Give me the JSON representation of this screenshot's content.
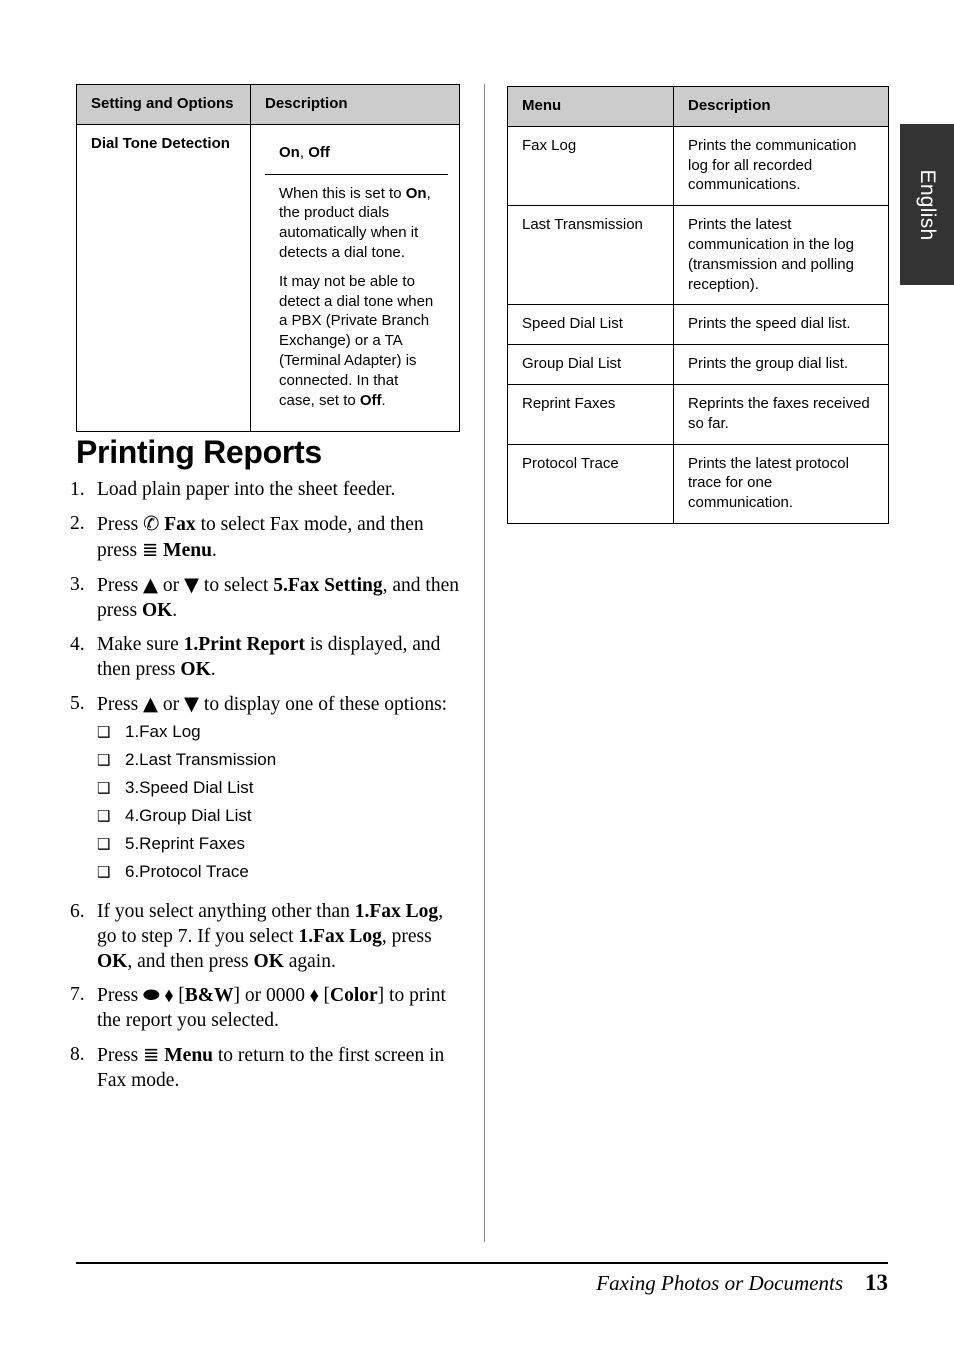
{
  "language_tab": {
    "label": "English"
  },
  "left_table": {
    "headers": [
      "Setting and Options",
      "Description"
    ],
    "row": {
      "setting": "Dial Tone Detection",
      "options_line_a": "On",
      "options_sep": ", ",
      "options_line_b": "Off",
      "desc_p1_a": "When this is set to ",
      "desc_p1_bold": "On",
      "desc_p1_b": ", the product dials automatically when it detects a dial tone.",
      "desc_p2_a": "It may not be able to detect a dial tone when a PBX (Private Branch Exchange) or a TA (Terminal Adapter) is connected. In that case, set to ",
      "desc_p2_bold": "Off",
      "desc_p2_b": "."
    }
  },
  "section": {
    "title": "Printing Reports"
  },
  "steps": [
    {
      "num": "1.",
      "parts": [
        {
          "t": "Load plain paper into the sheet feeder."
        }
      ]
    },
    {
      "num": "2.",
      "parts": [
        {
          "t": "Press "
        },
        {
          "t": "✆",
          "icon": "fax-icon"
        },
        {
          "t": " "
        },
        {
          "t": "Fax",
          "b": true
        },
        {
          "t": " to select Fax mode, and then press "
        },
        {
          "t": "≣",
          "icon": "menu-icon"
        },
        {
          "t": " "
        },
        {
          "t": "Menu",
          "b": true
        },
        {
          "t": "."
        }
      ]
    },
    {
      "num": "3.",
      "parts": [
        {
          "t": "Press "
        },
        {
          "t": "▲",
          "icon": "up-arrow-icon"
        },
        {
          "t": " or "
        },
        {
          "t": "▼",
          "icon": "down-arrow-icon"
        },
        {
          "t": " to select "
        },
        {
          "t": "5.Fax Setting",
          "b": true
        },
        {
          "t": ", and then press "
        },
        {
          "t": "OK",
          "b": true
        },
        {
          "t": "."
        }
      ]
    },
    {
      "num": "4.",
      "parts": [
        {
          "t": "Make sure "
        },
        {
          "t": "1.Print Report",
          "b": true
        },
        {
          "t": " is displayed, and then press "
        },
        {
          "t": "OK",
          "b": true
        },
        {
          "t": "."
        }
      ]
    },
    {
      "num": "5.",
      "parts": [
        {
          "t": "Press "
        },
        {
          "t": "▲",
          "icon": "up-arrow-icon"
        },
        {
          "t": " or "
        },
        {
          "t": "▼",
          "icon": "down-arrow-icon"
        },
        {
          "t": " to display one of these options:"
        }
      ]
    },
    {
      "num": "6.",
      "parts": [
        {
          "t": "If you select anything other than "
        },
        {
          "t": "1.Fax Log",
          "b": true
        },
        {
          "t": ", go to step 7. If you select "
        },
        {
          "t": "1.Fax Log",
          "b": true
        },
        {
          "t": ", press "
        },
        {
          "t": "OK",
          "b": true
        },
        {
          "t": ", and then press "
        },
        {
          "t": "OK",
          "b": true
        },
        {
          "t": " again."
        }
      ]
    },
    {
      "num": "7.",
      "parts": [
        {
          "t": "Press "
        },
        {
          "t": "⬬",
          "icon": "ink-drop-icon"
        },
        {
          "t": " "
        },
        {
          "t": "⬧",
          "icon": "start-diamond-icon"
        },
        {
          "t": " ["
        },
        {
          "t": "B&W",
          "b": true
        },
        {
          "t": "] or 0000 "
        },
        {
          "t": "⬧",
          "icon": "start-diamond-icon"
        },
        {
          "t": " ["
        },
        {
          "t": "Color",
          "b": true
        },
        {
          "t": "] to print the report you selected."
        }
      ]
    },
    {
      "num": "8.",
      "parts": [
        {
          "t": "Press "
        },
        {
          "t": "≣",
          "icon": "menu-icon"
        },
        {
          "t": " "
        },
        {
          "t": "Menu",
          "b": true
        },
        {
          "t": " to return to the first screen in Fax mode."
        }
      ]
    }
  ],
  "options": {
    "bullet": "❑",
    "items": [
      "1.Fax Log",
      "2.Last Transmission",
      "3.Speed Dial List",
      "4.Group Dial List",
      "5.Reprint Faxes",
      "6.Protocol Trace"
    ]
  },
  "right_table": {
    "headers": [
      "Menu",
      "Description"
    ],
    "rows": [
      {
        "menu": "Fax Log",
        "description": "Prints the communication log for all recorded communications."
      },
      {
        "menu": "Last Transmission",
        "description": "Prints the latest communication in the log (transmission and polling reception)."
      },
      {
        "menu": "Speed Dial List",
        "description": "Prints the speed dial list."
      },
      {
        "menu": "Group Dial List",
        "description": "Prints the group dial list."
      },
      {
        "menu": "Reprint Faxes",
        "description": "Reprints the faxes received so far."
      },
      {
        "menu": "Protocol Trace",
        "description": "Prints the latest protocol trace for one communication."
      }
    ]
  },
  "footer": {
    "title": "Faxing Photos or Documents",
    "page": "13"
  }
}
